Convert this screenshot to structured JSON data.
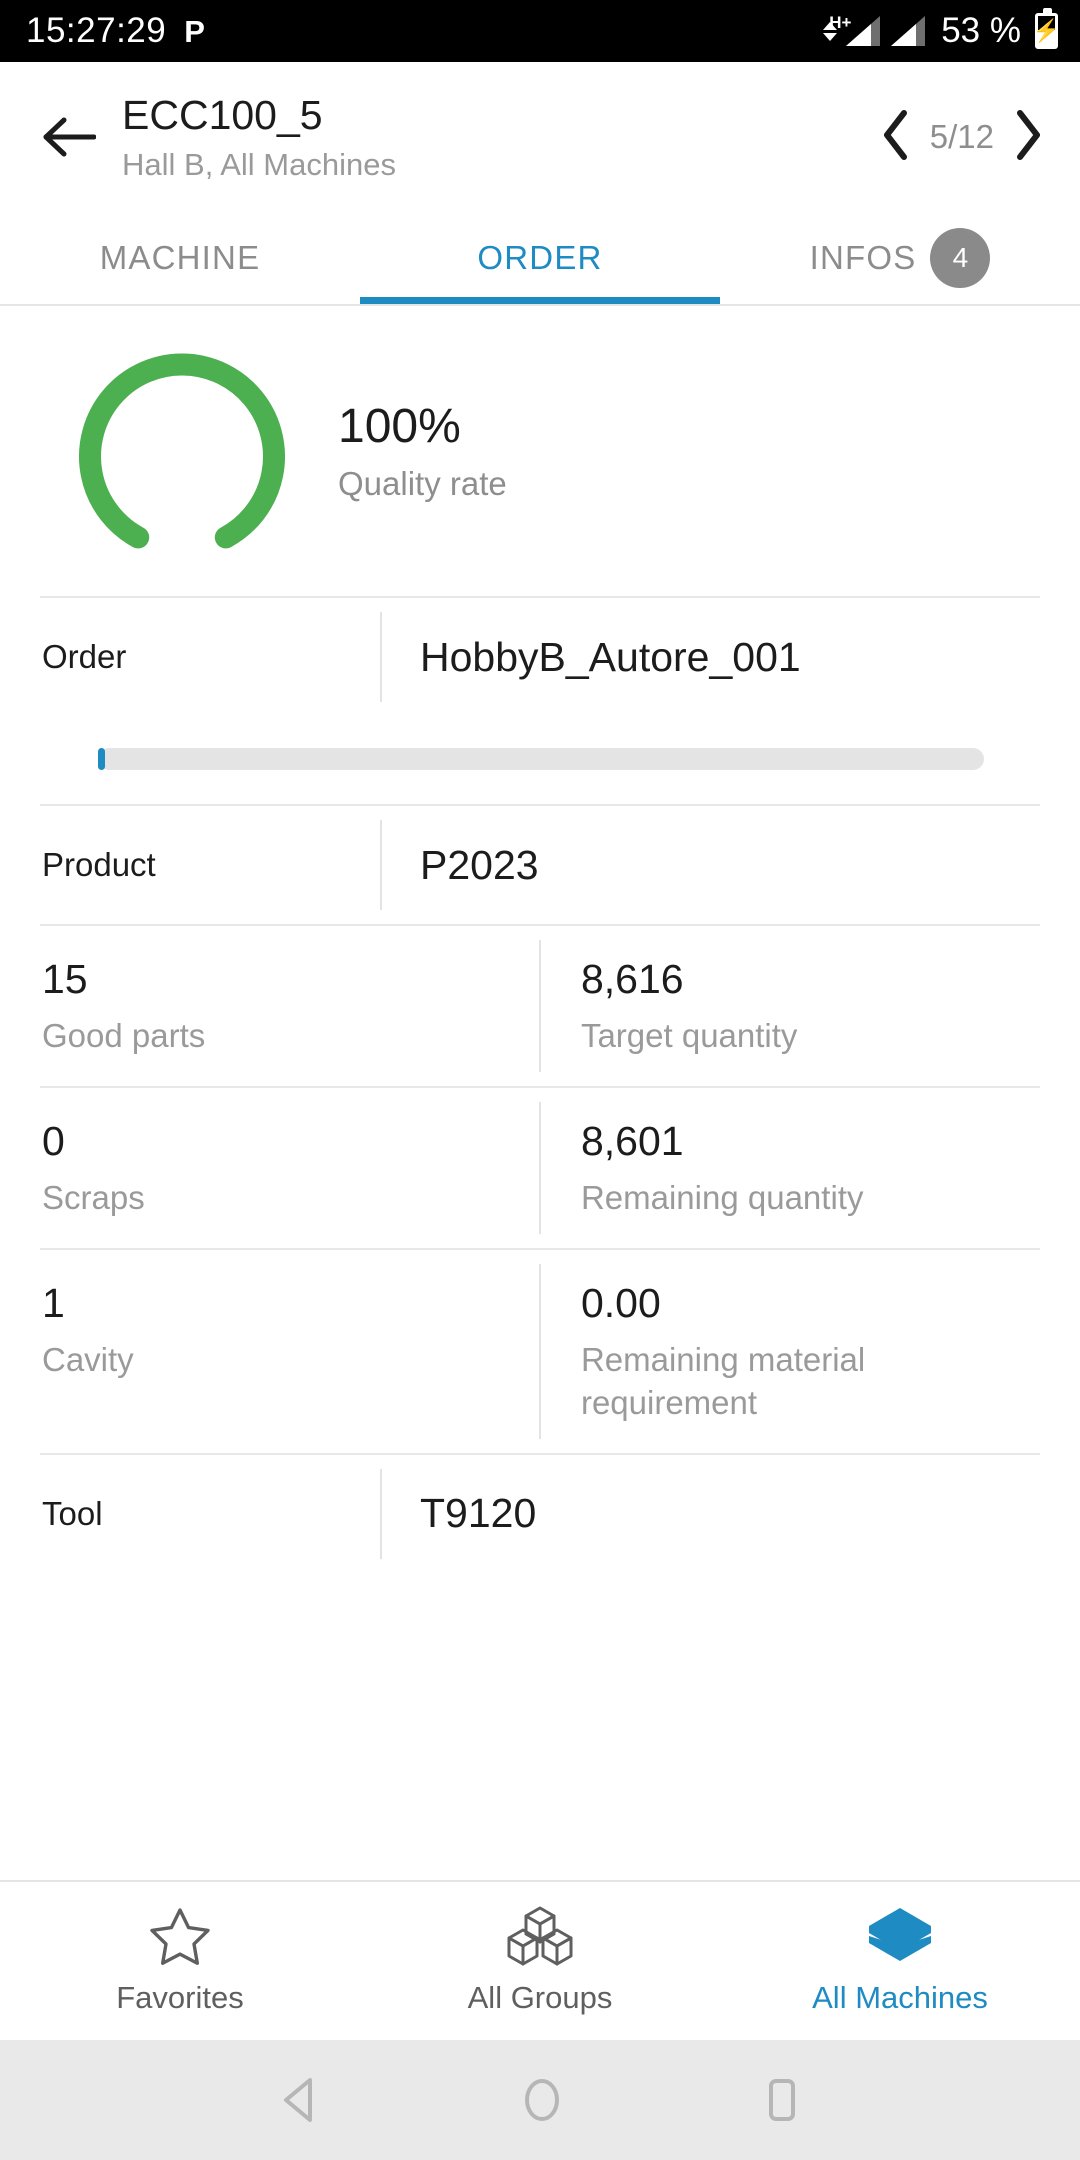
{
  "status_bar": {
    "time": "15:27:29",
    "app_icon_glyph": "P",
    "network_type": "H+",
    "battery_text": "53 %"
  },
  "header": {
    "back_icon": "arrow-left-icon",
    "title": "ECC100_5",
    "subtitle": "Hall B, All Machines",
    "pager": {
      "prev_icon": "chevron-left-icon",
      "count": "5/12",
      "next_icon": "chevron-right-icon"
    }
  },
  "tabs": [
    {
      "label": "MACHINE",
      "active": false,
      "badge": ""
    },
    {
      "label": "ORDER",
      "active": true,
      "badge": ""
    },
    {
      "label": "INFOS",
      "active": false,
      "badge": "4"
    }
  ],
  "gauge": {
    "value": "100%",
    "label": "Quality rate",
    "color": "#4caf50",
    "percent": 100
  },
  "order_row": {
    "key": "Order",
    "value": "HobbyB_Autore_001"
  },
  "progress": {
    "percent": "0.17",
    "fill_color": "#1e8bc3",
    "track_color": "#e4e4e4"
  },
  "product_row": {
    "key": "Product",
    "value": "P2023"
  },
  "stats": [
    {
      "left_value": "15",
      "left_label": "Good parts",
      "right_value": "8,616",
      "right_label": "Target quantity"
    },
    {
      "left_value": "0",
      "left_label": "Scraps",
      "right_value": "8,601",
      "right_label": "Remaining quantity"
    },
    {
      "left_value": "1",
      "left_label": "Cavity",
      "right_value": "0.00",
      "right_label": "Remaining material requirement"
    }
  ],
  "tool_row": {
    "key": "Tool",
    "value": "T9120"
  },
  "bottom_nav": [
    {
      "label": "Favorites",
      "icon": "star-outline-icon",
      "active": false
    },
    {
      "label": "All Groups",
      "icon": "cubes-icon",
      "active": false
    },
    {
      "label": "All Machines",
      "icon": "layers-icon",
      "active": true
    }
  ],
  "android_nav": {
    "back_icon": "triangle-back-icon",
    "home_icon": "circle-home-icon",
    "recents_icon": "square-recents-icon"
  },
  "theme": {
    "accent_blue": "#1e8bc3",
    "green": "#4caf50",
    "badge_gray": "#8a8a8a"
  }
}
